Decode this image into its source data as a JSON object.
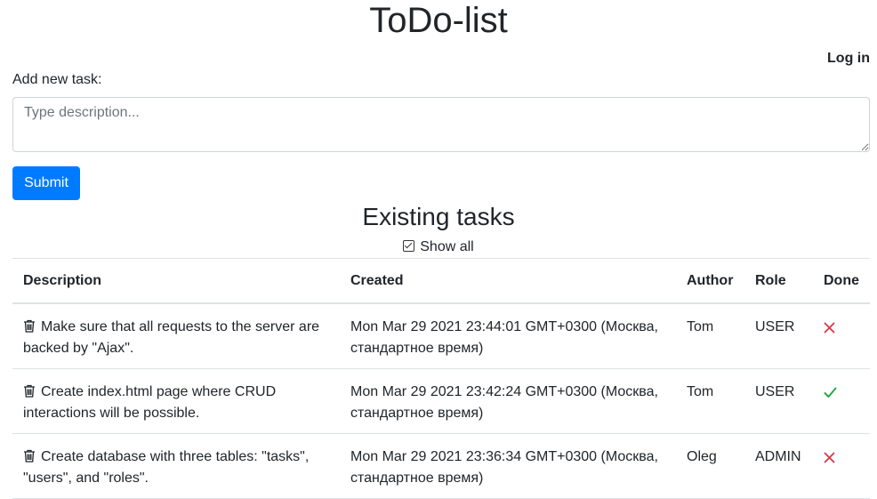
{
  "app": {
    "title": "ToDo-list",
    "login_label": "Log in"
  },
  "form": {
    "label": "Add new task:",
    "placeholder": "Type description...",
    "submit_label": "Submit"
  },
  "tasks_section": {
    "title": "Existing tasks",
    "show_all_label": "Show all",
    "show_all_checked": true
  },
  "table": {
    "headers": {
      "description": "Description",
      "created": "Created",
      "author": "Author",
      "role": "Role",
      "done": "Done"
    },
    "rows": [
      {
        "description": "Make sure that all requests to the server are backed by \"Ajax\".",
        "created": "Mon Mar 29 2021 23:44:01 GMT+0300 (Москва, стандартное время)",
        "author": "Tom",
        "role": "USER",
        "done": false,
        "done_icon": "cross-icon"
      },
      {
        "description": "Create index.html page where CRUD interactions will be possible.",
        "created": "Mon Mar 29 2021 23:42:24 GMT+0300 (Москва, стандартное время)",
        "author": "Tom",
        "role": "USER",
        "done": true,
        "done_icon": "check-icon"
      },
      {
        "description": "Create database with three tables: \"tasks\", \"users\", and \"roles\".",
        "created": "Mon Mar 29 2021 23:36:34 GMT+0300 (Москва, стандартное время)",
        "author": "Oleg",
        "role": "ADMIN",
        "done": false,
        "done_icon": "cross-icon"
      }
    ]
  },
  "colors": {
    "primary": "#007bff",
    "done_true": "#28a745",
    "done_false": "#dc3545",
    "text": "#212529"
  }
}
